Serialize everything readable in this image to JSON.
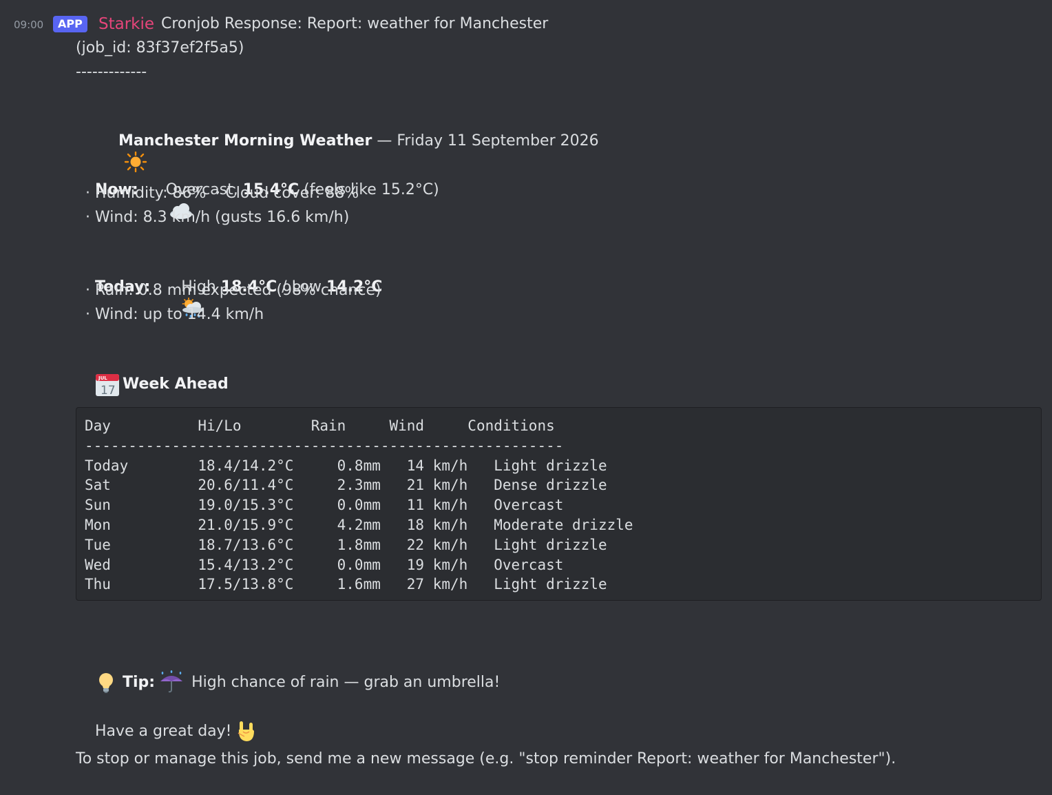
{
  "message": {
    "timestamp": "09:00",
    "badge": "APP",
    "author": "Starkie",
    "header_text": "Cronjob Response: Report: weather for Manchester",
    "job_id_line": "(job_id: 83f37ef2f5a5)",
    "separator": "-------------",
    "title_bold": "Manchester Morning Weather",
    "title_rest": " — Friday 11 September 2026",
    "now_label": "Now:",
    "now_condition": "Overcast, ",
    "now_temp": "15.4°C",
    "now_feels": " (feels like 15.2°C)",
    "now_humidity_line": "  · Humidity: 86%  · Cloud cover: 88%",
    "now_wind_line": "  · Wind: 8.3 km/h (gusts 16.6 km/h)",
    "today_label": "Today:",
    "today_high_label": " High ",
    "today_high": "18.4°C",
    "today_sep": " / Low ",
    "today_low": "14.2°C",
    "today_rain_line": "  · Rain: 0.8 mm expected (98% chance)",
    "today_wind_line": "  · Wind: up to 14.4 km/h",
    "week_title": "Week Ahead",
    "calendar_month": "JUL",
    "calendar_day": "17",
    "table": {
      "header": "Day          Hi/Lo        Rain     Wind     Conditions",
      "divider": "-------------------------------------------------------",
      "rows": [
        "Today        18.4/14.2°C     0.8mm   14 km/h   Light drizzle",
        "Sat          20.6/11.4°C     2.3mm   21 km/h   Dense drizzle",
        "Sun          19.0/15.3°C     0.0mm   11 km/h   Overcast",
        "Mon          21.0/15.9°C     4.2mm   18 km/h   Moderate drizzle",
        "Tue          18.7/13.6°C     1.8mm   22 km/h   Light drizzle",
        "Wed          15.4/13.2°C     0.0mm   19 km/h   Overcast",
        "Thu          17.5/13.8°C     1.6mm   27 km/h   Light drizzle"
      ]
    },
    "tip_label": "Tip:",
    "tip_text": " High chance of rain — grab an umbrella!",
    "closing": "Have a great day! ",
    "footer": "To stop or manage this job, send me a new message (e.g. \"stop reminder Report: weather for Manchester\")."
  },
  "icons": {
    "sun": "sun-icon",
    "cloud": "cloud-icon",
    "rain_cloud": "sun-behind-rain-cloud-icon",
    "calendar": "calendar-icon",
    "bulb": "light-bulb-icon",
    "umbrella": "umbrella-with-rain-icon",
    "rock_hand": "sign-of-the-horns-icon"
  },
  "colors": {
    "background": "#313338",
    "author": "#e6457a",
    "badge": "#5865f2",
    "code_bg": "#2b2d31"
  }
}
